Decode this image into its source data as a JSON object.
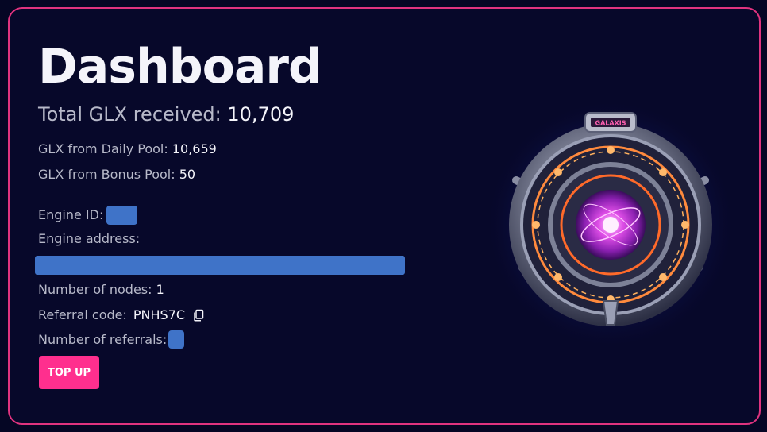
{
  "dashboard": {
    "title": "Dashboard",
    "total_label": "Total GLX received: ",
    "total_value": "10,709",
    "daily_label": "GLX from Daily Pool: ",
    "daily_value": "10,659",
    "bonus_label": "GLX from Bonus Pool: ",
    "bonus_value": "50",
    "engine_id_label": "Engine ID:",
    "engine_address_label": "Engine address:",
    "nodes_label": "Number of nodes: ",
    "nodes_value": "1",
    "referral_label": "Referral code: ",
    "referral_code": "PNHS7C",
    "referrals_label": "Number of referrals:",
    "topup_label": "TOP UP"
  },
  "engine_image": {
    "badge_text": "GALAXIS"
  },
  "icons": {
    "copy": "copy-icon"
  },
  "colors": {
    "background": "#07082a",
    "border": "#e0337f",
    "accent_button": "#ff2f8e",
    "redaction": "#3f73c8"
  }
}
